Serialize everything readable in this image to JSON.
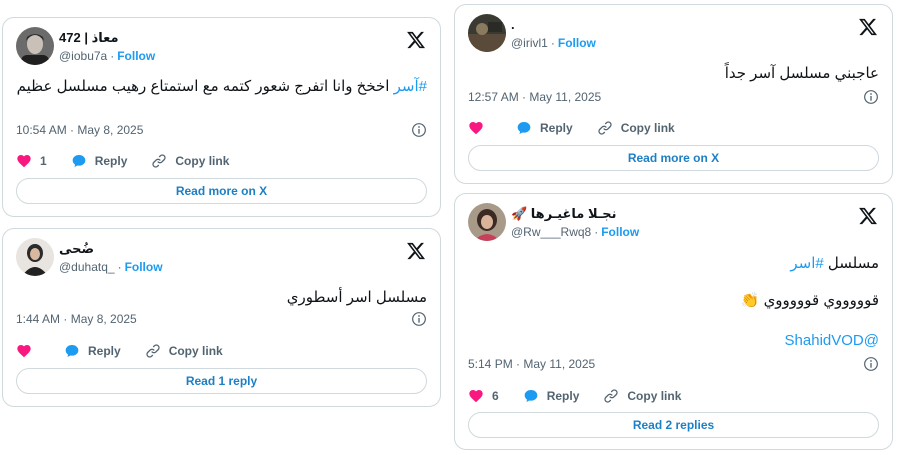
{
  "tweets": [
    {
      "display_name": "معاذ | 472",
      "handle": "@iobu7a",
      "follow_label": "Follow",
      "text_hashtag": "#آسر",
      "text_body": " اخخخ وانا اتفرج شعور كتمه مع استمتاع رهيب مسلسل عظيم",
      "timestamp": "10:54 AM · May 8, 2025",
      "likes": "1",
      "reply_label": "Reply",
      "copy_label": "Copy link",
      "button_label": "Read more on X"
    },
    {
      "display_name": "ضُحى",
      "handle": "@duhatq_",
      "follow_label": "Follow",
      "text": "مسلسل اسر أسطوري",
      "timestamp": "1:44 AM · May 8, 2025",
      "reply_label": "Reply",
      "copy_label": "Copy link",
      "button_label": "Read 1 reply"
    },
    {
      "display_name": ".",
      "handle": "@irivl1",
      "follow_label": "Follow",
      "text": "عاجبني مسلسل آسر جداً",
      "timestamp": "12:57 AM · May 11, 2025",
      "reply_label": "Reply",
      "copy_label": "Copy link",
      "button_label": "Read more on X"
    },
    {
      "display_name": "نجـلا ماغيـرها 🚀",
      "handle": "@Rw___Rwq8",
      "follow_label": "Follow",
      "text_prefix": "مسلسل ",
      "text_hashtag": "#اسر",
      "text_line2": "قوووووي قوووووي 👏",
      "text_mention": "@ShahidVOD",
      "timestamp": "5:14 PM · May 11, 2025",
      "likes": "6",
      "reply_label": "Reply",
      "copy_label": "Copy link",
      "button_label": "Read 2 replies"
    }
  ],
  "colors": {
    "accent": "#1d9bf0",
    "heart": "#f91880",
    "border": "#cfd9de",
    "muted": "#536471"
  },
  "icons": [
    "x-logo-icon",
    "info-icon",
    "heart-icon",
    "reply-bubble-icon",
    "link-icon"
  ]
}
